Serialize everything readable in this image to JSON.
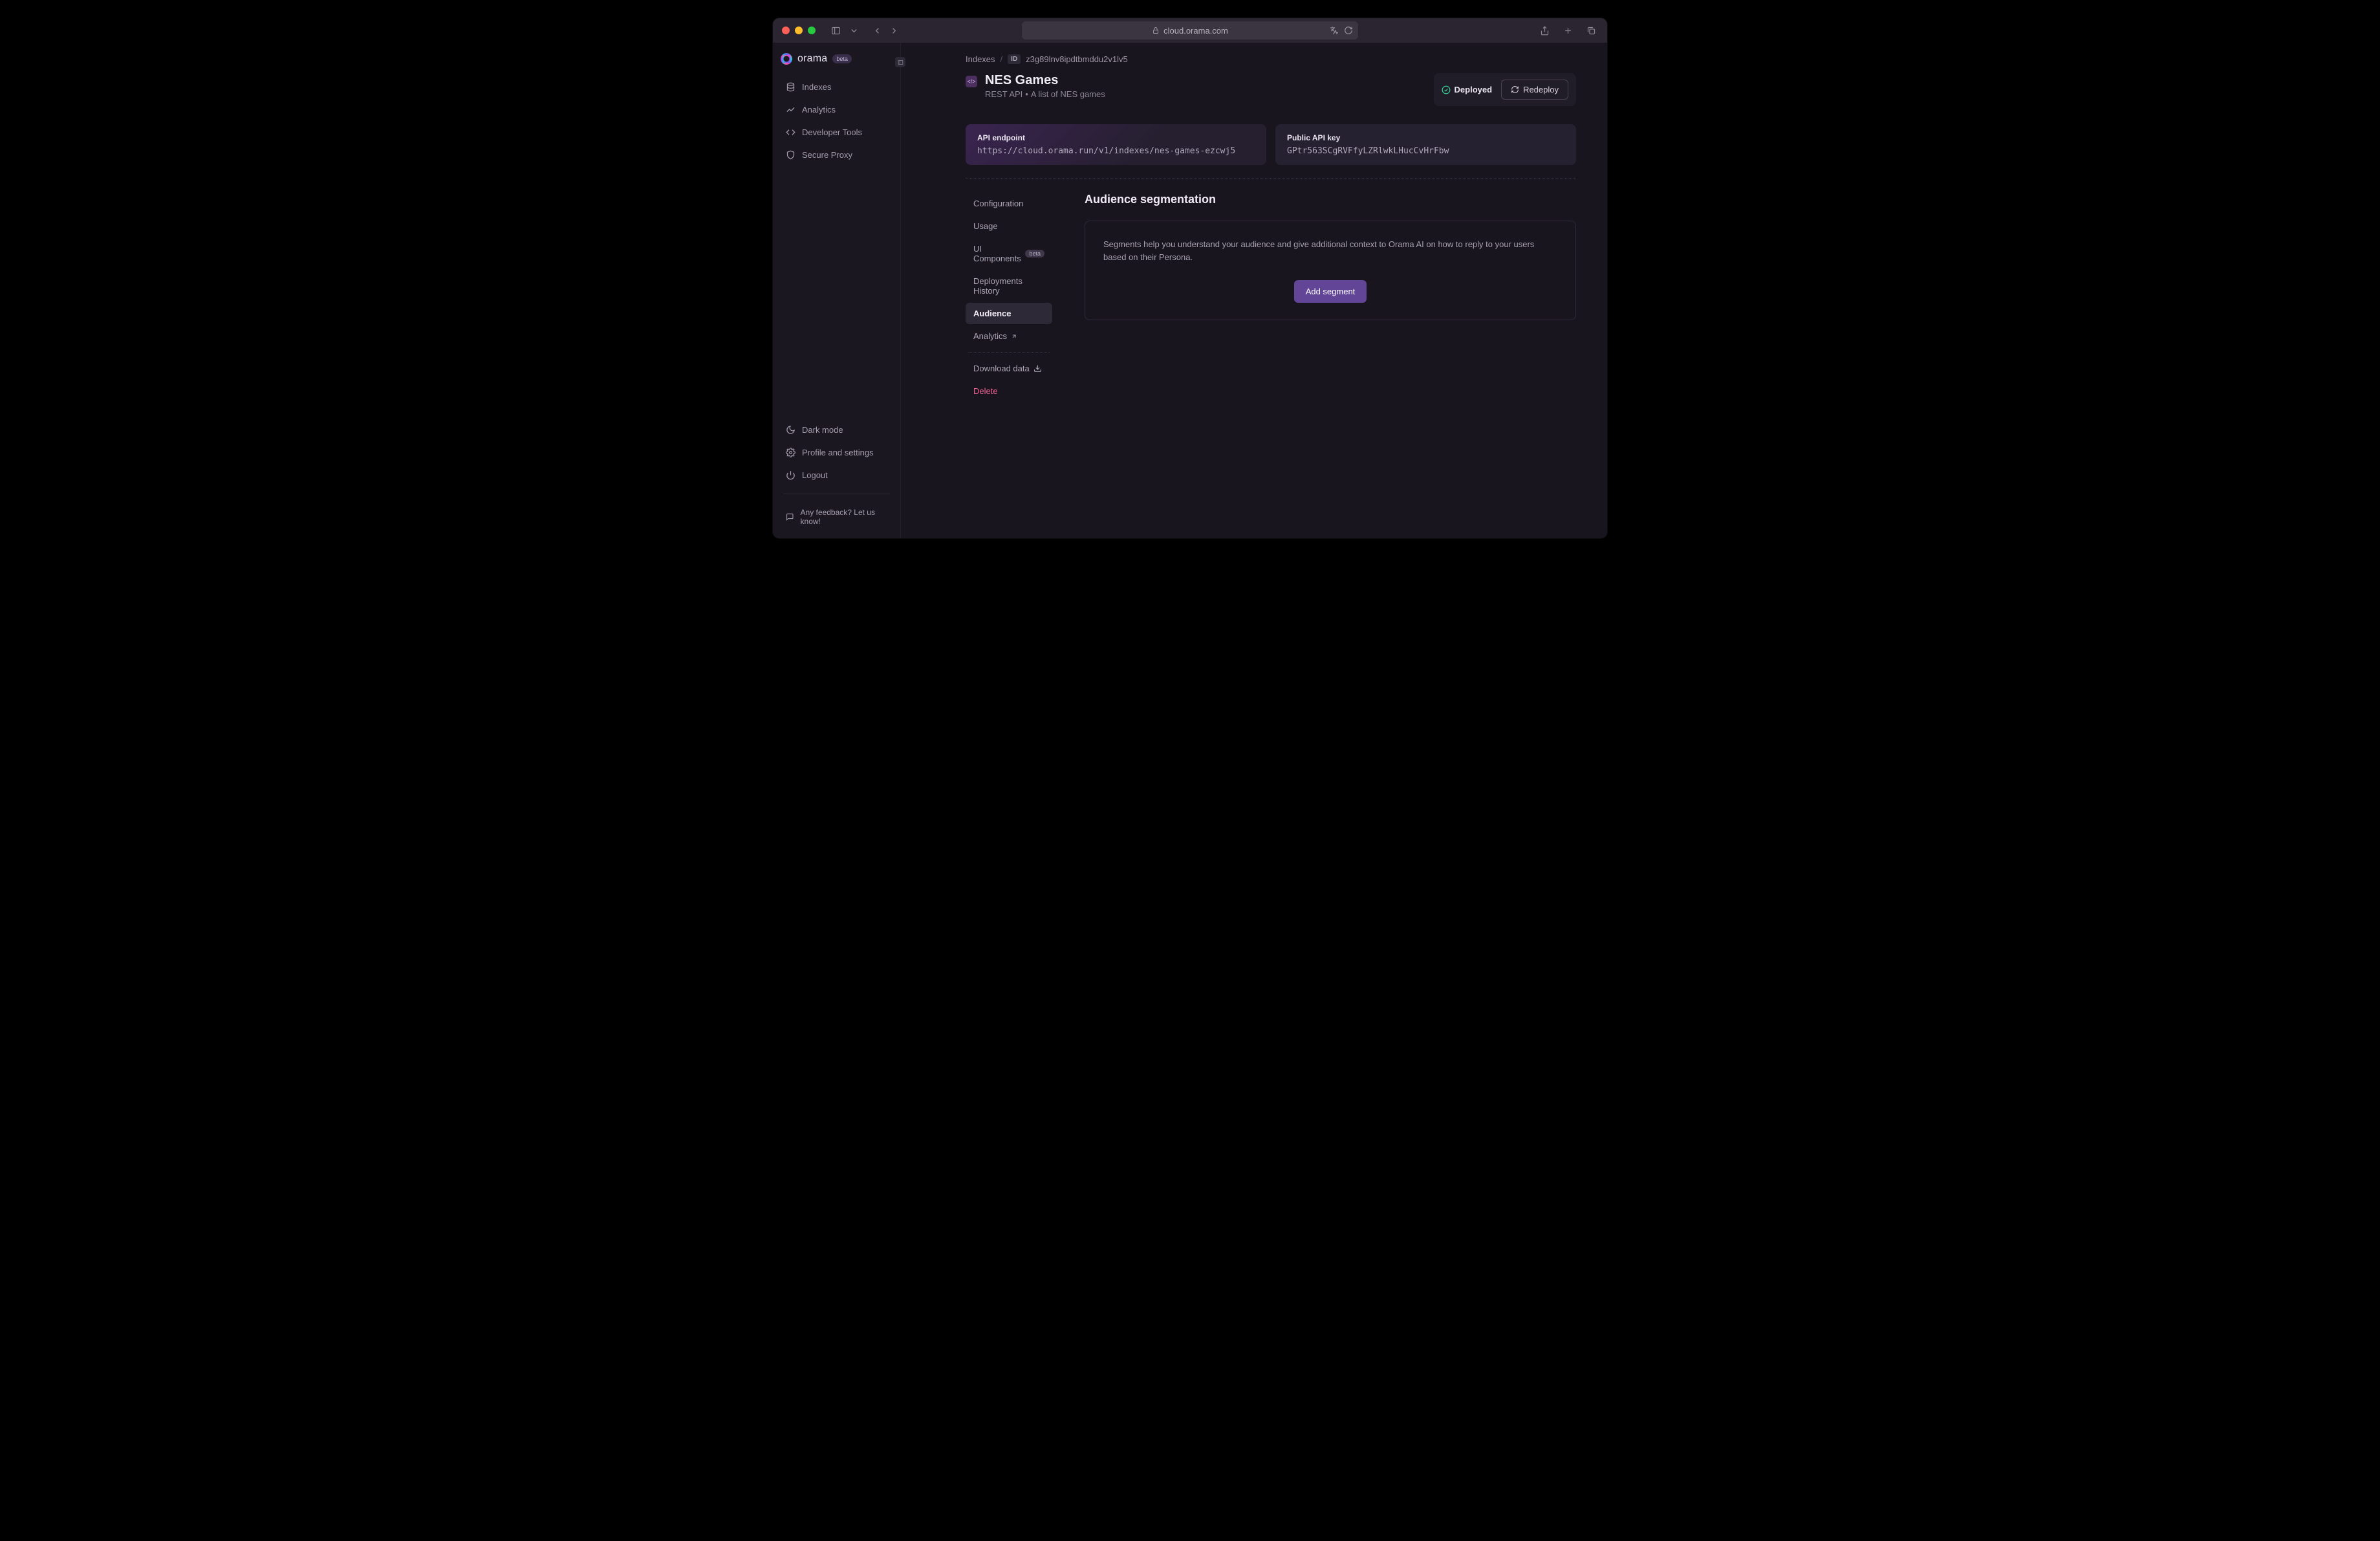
{
  "browser": {
    "url": "cloud.orama.com"
  },
  "brand": {
    "name": "orama",
    "badge": "beta"
  },
  "sidebar": {
    "items": [
      {
        "label": "Indexes"
      },
      {
        "label": "Analytics"
      },
      {
        "label": "Developer Tools"
      },
      {
        "label": "Secure Proxy"
      }
    ],
    "bottom": [
      {
        "label": "Dark mode"
      },
      {
        "label": "Profile and settings"
      },
      {
        "label": "Logout"
      }
    ],
    "feedback": "Any feedback? Let us know!"
  },
  "breadcrumb": {
    "root": "Indexes",
    "idLabel": "ID",
    "id": "z3g89lnv8ipdtbmddu2v1lv5"
  },
  "page": {
    "iconText": "</>",
    "title": "NES Games",
    "apiType": "REST API",
    "description": "A list of NES games"
  },
  "status": {
    "label": "Deployed",
    "action": "Redeploy"
  },
  "cards": {
    "endpoint": {
      "label": "API endpoint",
      "value": "https://cloud.orama.run/v1/indexes/nes-games-ezcwj5"
    },
    "apikey": {
      "label": "Public API key",
      "value": "GPtr563SCgRVFfyLZRlwkLHucCvHrFbw"
    }
  },
  "subnav": {
    "items": [
      {
        "label": "Configuration"
      },
      {
        "label": "Usage"
      },
      {
        "label": "UI Components",
        "badge": "beta"
      },
      {
        "label": "Deployments History"
      },
      {
        "label": "Audience",
        "active": true
      },
      {
        "label": "Analytics",
        "external": true
      }
    ],
    "download": "Download data",
    "delete": "Delete"
  },
  "panel": {
    "title": "Audience segmentation",
    "description": "Segments help you understand your audience and give additional context to Orama AI on how to reply to your users based on their Persona.",
    "action": "Add segment"
  }
}
